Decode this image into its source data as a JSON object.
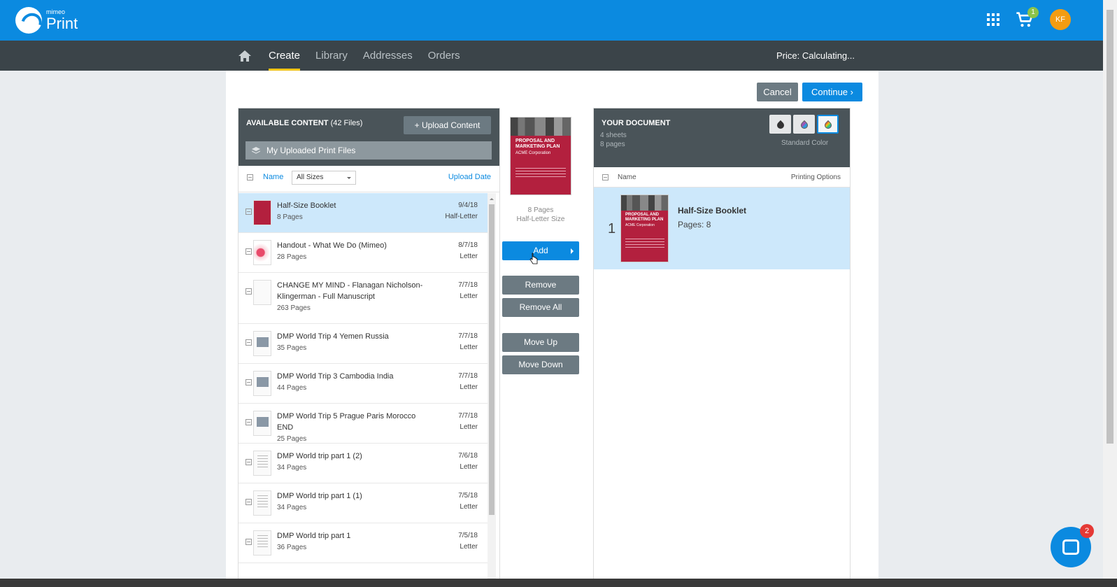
{
  "app": {
    "brand_small": "mimeo",
    "brand_big": "Print"
  },
  "topbar": {
    "cart_count": "1",
    "avatar_initials": "KF"
  },
  "nav": {
    "items": [
      {
        "label": "Create"
      },
      {
        "label": "Library"
      },
      {
        "label": "Addresses"
      },
      {
        "label": "Orders"
      }
    ],
    "price": "Price:  Calculating..."
  },
  "actions": {
    "cancel": "Cancel",
    "continue": "Continue"
  },
  "available": {
    "title": "AVAILABLE CONTENT",
    "count": "(42 Files)",
    "upload": "Upload Content",
    "folder": "My Uploaded Print Files",
    "col_name": "Name",
    "size_filter": "All Sizes",
    "col_date": "Upload Date",
    "files": [
      {
        "name": "Half-Size Booklet",
        "pages": "8 Pages",
        "date": "9/4/18",
        "size": "Half-Letter"
      },
      {
        "name": "Handout - What We Do (Mimeo)",
        "pages": "28 Pages",
        "date": "8/7/18",
        "size": "Letter"
      },
      {
        "name": "CHANGE MY MIND - Flanagan Nicholson-Klingerman - Full Manuscript",
        "pages": "263 Pages",
        "date": "7/7/18",
        "size": "Letter"
      },
      {
        "name": "DMP World Trip 4 Yemen Russia",
        "pages": "35 Pages",
        "date": "7/7/18",
        "size": "Letter"
      },
      {
        "name": "DMP World Trip 3 Cambodia India",
        "pages": "44 Pages",
        "date": "7/7/18",
        "size": "Letter"
      },
      {
        "name": "DMP World Trip 5 Prague Paris Morocco END",
        "pages": "25 Pages",
        "date": "7/7/18",
        "size": "Letter"
      },
      {
        "name": "DMP World trip part 1 (2)",
        "pages": "34 Pages",
        "date": "7/6/18",
        "size": "Letter"
      },
      {
        "name": "DMP World trip part 1 (1)",
        "pages": "34 Pages",
        "date": "7/5/18",
        "size": "Letter"
      },
      {
        "name": "DMP World trip part 1",
        "pages": "36 Pages",
        "date": "7/5/18",
        "size": "Letter"
      }
    ]
  },
  "preview": {
    "title": "PROPOSAL AND MARKETING PLAN",
    "company": "ACME Corporation",
    "pages": "8 Pages",
    "size": "Half-Letter Size"
  },
  "middle_buttons": {
    "add": "Add",
    "remove": "Remove",
    "remove_all": "Remove All",
    "move_up": "Move Up",
    "move_down": "Move Down"
  },
  "document": {
    "title": "YOUR DOCUMENT",
    "sheets": "4 sheets",
    "pages": "8 pages",
    "color_mode": "Standard Color",
    "col_name": "Name",
    "col_options": "Printing Options",
    "items": [
      {
        "index": "1",
        "name": "Half-Size Booklet",
        "pages": "Pages: 8"
      }
    ]
  },
  "chat": {
    "badge": "2"
  },
  "colors": {
    "primary": "#0b8ae0",
    "nav_bg": "#3b4449",
    "selected_row": "#cde8fb",
    "booklet_red": "#b3203e"
  }
}
